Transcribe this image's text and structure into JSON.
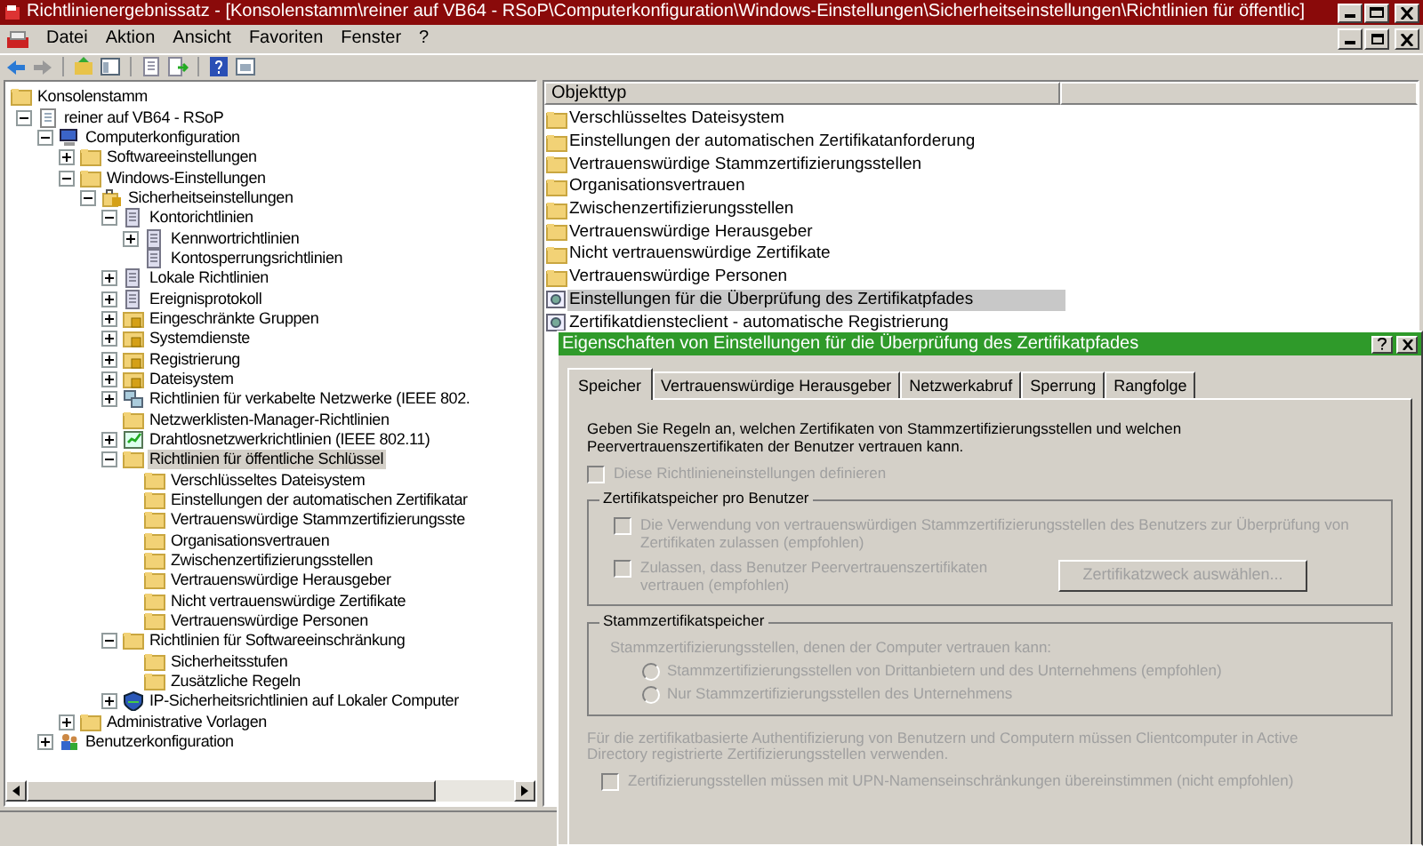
{
  "window": {
    "title": "Richtlinienergebnissatz - [Konsolenstamm\\reiner auf VB64 - RSoP\\Computerkonfiguration\\Windows-Einstellungen\\Sicherheitseinstellungen\\Richtlinien für öffentlic]"
  },
  "menu": [
    "Datei",
    "Aktion",
    "Ansicht",
    "Favoriten",
    "Fenster",
    "?"
  ],
  "tree": [
    {
      "label": "Konsolenstamm",
      "kind": "folder",
      "selected": false,
      "children": [
        {
          "label": "reiner auf VB64 - RSoP",
          "kind": "doc",
          "expanded": true,
          "selected": false,
          "children": [
            {
              "label": "Computerkonfiguration",
              "kind": "computer",
              "expanded": true,
              "selected": false,
              "children": [
                {
                  "label": "Softwareeinstellungen",
                  "kind": "folder",
                  "expanded": false,
                  "selected": false
                },
                {
                  "label": "Windows-Einstellungen",
                  "kind": "folder",
                  "expanded": true,
                  "selected": false,
                  "children": [
                    {
                      "label": "Sicherheitseinstellungen",
                      "kind": "security",
                      "expanded": true,
                      "selected": false,
                      "children": [
                        {
                          "label": "Kontorichtlinien",
                          "kind": "policy",
                          "expanded": true,
                          "selected": false,
                          "children": [
                            {
                              "label": "Kennwortrichtlinien",
                              "kind": "policy",
                              "expanded": false,
                              "selected": false
                            },
                            {
                              "label": "Kontosperrungsrichtlinien",
                              "kind": "policy",
                              "selected": false
                            }
                          ]
                        },
                        {
                          "label": "Lokale Richtlinien",
                          "kind": "policy",
                          "expanded": false,
                          "selected": false
                        },
                        {
                          "label": "Ereignisprotokoll",
                          "kind": "policy",
                          "expanded": false,
                          "selected": false
                        },
                        {
                          "label": "Eingeschränkte Gruppen",
                          "kind": "lockfolder",
                          "expanded": false,
                          "selected": false
                        },
                        {
                          "label": "Systemdienste",
                          "kind": "lockfolder",
                          "expanded": false,
                          "selected": false
                        },
                        {
                          "label": "Registrierung",
                          "kind": "lockfolder",
                          "expanded": false,
                          "selected": false
                        },
                        {
                          "label": "Dateisystem",
                          "kind": "lockfolder",
                          "expanded": false,
                          "selected": false
                        },
                        {
                          "label": "Richtlinien für verkabelte Netzwerke (IEEE 802.",
                          "kind": "network",
                          "expanded": false,
                          "selected": false
                        },
                        {
                          "label": "Netzwerklisten-Manager-Richtlinien",
                          "kind": "folder",
                          "selected": false
                        },
                        {
                          "label": "Drahtlosnetzwerkrichtlinien (IEEE 802.11)",
                          "kind": "wireless",
                          "expanded": false,
                          "selected": false
                        },
                        {
                          "label": "Richtlinien für öffentliche Schlüssel",
                          "kind": "folder",
                          "expanded": true,
                          "selected": true,
                          "children": [
                            {
                              "label": "Verschlüsseltes Dateisystem",
                              "kind": "folder",
                              "selected": false
                            },
                            {
                              "label": "Einstellungen der automatischen Zertifikatar",
                              "kind": "folder",
                              "selected": false
                            },
                            {
                              "label": "Vertrauenswürdige Stammzertifizierungsste",
                              "kind": "folder",
                              "selected": false
                            },
                            {
                              "label": "Organisationsvertrauen",
                              "kind": "folder",
                              "selected": false
                            },
                            {
                              "label": "Zwischenzertifizierungsstellen",
                              "kind": "folder",
                              "selected": false
                            },
                            {
                              "label": "Vertrauenswürdige Herausgeber",
                              "kind": "folder",
                              "selected": false
                            },
                            {
                              "label": "Nicht vertrauenswürdige Zertifikate",
                              "kind": "folder",
                              "selected": false
                            },
                            {
                              "label": "Vertrauenswürdige Personen",
                              "kind": "folder",
                              "selected": false
                            }
                          ]
                        },
                        {
                          "label": "Richtlinien für Softwareeinschränkung",
                          "kind": "folder",
                          "expanded": true,
                          "selected": false,
                          "children": [
                            {
                              "label": "Sicherheitsstufen",
                              "kind": "folder",
                              "selected": false
                            },
                            {
                              "label": "Zusätzliche Regeln",
                              "kind": "folder",
                              "selected": false
                            }
                          ]
                        },
                        {
                          "label": "IP-Sicherheitsrichtlinien auf Lokaler Computer",
                          "kind": "ipsec",
                          "expanded": false,
                          "selected": false
                        }
                      ]
                    }
                  ]
                },
                {
                  "label": "Administrative Vorlagen",
                  "kind": "folder",
                  "expanded": false,
                  "selected": false
                }
              ]
            },
            {
              "label": "Benutzerkonfiguration",
              "kind": "users",
              "expanded": false,
              "selected": false
            }
          ]
        }
      ]
    }
  ],
  "list": {
    "column": "Objekttyp",
    "rows": [
      {
        "label": "Verschlüsseltes Dateisystem",
        "kind": "folder",
        "selected": false
      },
      {
        "label": "Einstellungen der automatischen Zertifikatanforderung",
        "kind": "folder",
        "selected": false
      },
      {
        "label": "Vertrauenswürdige Stammzertifizierungsstellen",
        "kind": "folder",
        "selected": false
      },
      {
        "label": "Organisationsvertrauen",
        "kind": "folder",
        "selected": false
      },
      {
        "label": "Zwischenzertifizierungsstellen",
        "kind": "folder",
        "selected": false
      },
      {
        "label": "Vertrauenswürdige Herausgeber",
        "kind": "folder",
        "selected": false
      },
      {
        "label": "Nicht vertrauenswürdige Zertifikate",
        "kind": "folder",
        "selected": false
      },
      {
        "label": "Vertrauenswürdige Personen",
        "kind": "folder",
        "selected": false
      },
      {
        "label": "Einstellungen für die Überprüfung des Zertifikatpfades",
        "kind": "setting",
        "selected": true
      },
      {
        "label": "Zertifikatdiensteclient - automatische Registrierung",
        "kind": "setting",
        "selected": false
      }
    ]
  },
  "dialog": {
    "title": "Eigenschaften von Einstellungen für die Überprüfung des Zertifikatpfades",
    "tabs": [
      {
        "label": "Speicher",
        "selected": true
      },
      {
        "label": "Vertrauenswürdige Herausgeber",
        "selected": false
      },
      {
        "label": "Netzwerkabruf",
        "selected": false
      },
      {
        "label": "Sperrung",
        "selected": false
      },
      {
        "label": "Rangfolge",
        "selected": false
      }
    ],
    "description": "Geben Sie Regeln an, welchen Zertifikaten von Stammzertifizierungsstellen und welchen Peervertrauenszertifikaten der Benutzer vertrauen kann.",
    "define": {
      "label": "Diese Richtlinieneinstellungen definieren",
      "checked": false,
      "disabled": true
    },
    "user_store": {
      "title": "Zertifikatspeicher pro Benutzer",
      "options": [
        {
          "label": "Die Verwendung von vertrauenswürdigen Stammzertifizierungsstellen des Benutzers zur Überprüfung von Zertifikaten zulassen (empfohlen)",
          "checked": false,
          "disabled": true
        },
        {
          "label": "Zulassen, dass Benutzer Peervertrauenszertifikaten vertrauen (empfohlen)",
          "checked": false,
          "disabled": true
        }
      ],
      "button": {
        "label": "Zertifikatzweck auswählen...",
        "disabled": true
      }
    },
    "root_store": {
      "title": "Stammzertifikatspeicher",
      "prompt": "Stammzertifizierungsstellen, denen der Computer vertrauen kann:",
      "radios": [
        {
          "label": "Stammzertifizierungsstellen von Drittanbietern und des Unternehmens (empfohlen)",
          "selected": false,
          "disabled": true
        },
        {
          "label": "Nur Stammzertifizierungsstellen des Unternehmens",
          "selected": false,
          "disabled": true
        }
      ]
    },
    "note": "Für die zertifikatbasierte Authentifizierung von Benutzern und Computern müssen Clientcomputer in Active Directory registrierte Zertifizierungsstellen verwenden.",
    "upn": {
      "label": "Zertifizierungsstellen müssen mit UPN-Namenseinschränkungen übereinstimmen (nicht empfohlen)",
      "checked": false,
      "disabled": true
    }
  }
}
